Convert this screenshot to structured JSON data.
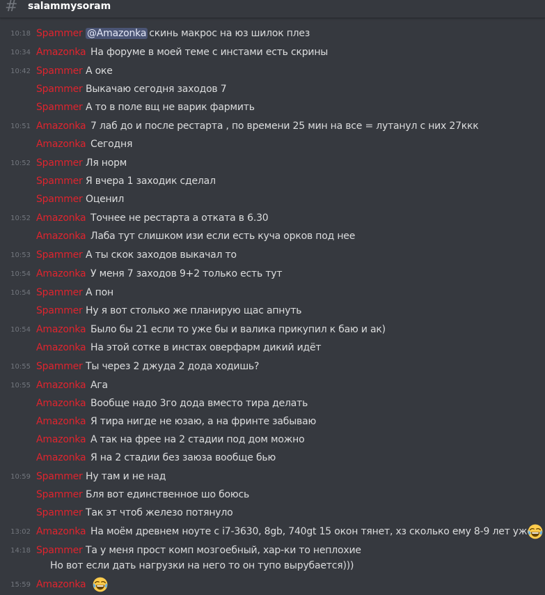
{
  "channel": {
    "name": "salammysoram"
  },
  "messages": [
    {
      "ts": "10:18",
      "author": "Spammer",
      "mention": "@Amazonka",
      "text": "скинь макрос на юз шилок плез"
    },
    {
      "ts": "10:34",
      "author": "Amazonka",
      "text": "На форуме в моей теме с инстами есть скрины"
    },
    {
      "ts": "10:42",
      "author": "Spammer",
      "text": "А оке"
    },
    {
      "ts": "",
      "author": "Spammer",
      "text": "Выкачаю сегодня заходов 7"
    },
    {
      "ts": "",
      "author": "Spammer",
      "text": "А то в поле вщ не варик фармить"
    },
    {
      "ts": "10:51",
      "author": "Amazonka",
      "text": "7 лаб до и после рестарта , по времени 25 мин на все = лутанул с них 27ккк"
    },
    {
      "ts": "",
      "author": "Amazonka",
      "text": "Сегодня"
    },
    {
      "ts": "10:52",
      "author": "Spammer",
      "text": "Ля норм"
    },
    {
      "ts": "",
      "author": "Spammer",
      "text": "Я вчера 1 заходик сделал"
    },
    {
      "ts": "",
      "author": "Spammer",
      "text": "Оценил"
    },
    {
      "ts": "10:52",
      "author": "Amazonka",
      "text": "Точнее не рестарта а отката в 6.30"
    },
    {
      "ts": "",
      "author": "Amazonka",
      "text": "Лаба тут слишком изи если есть куча орков под нее"
    },
    {
      "ts": "10:53",
      "author": "Spammer",
      "text": "А ты скок заходов выкачал то"
    },
    {
      "ts": "10:54",
      "author": "Amazonka",
      "text": "У меня 7 заходов 9+2 только есть тут"
    },
    {
      "ts": "10:54",
      "author": "Spammer",
      "text": "А пон"
    },
    {
      "ts": "",
      "author": "Spammer",
      "text": "Ну я вот столько же планирую щас апнуть"
    },
    {
      "ts": "10:54",
      "author": "Amazonka",
      "text": "Было бы 21 если то уже бы и валика прикупил к баю и ак)"
    },
    {
      "ts": "",
      "author": "Amazonka",
      "text": "На этой сотке в инстах оверфарм дикий идёт"
    },
    {
      "ts": "10:55",
      "author": "Spammer",
      "text": "Ты через 2 джуда 2 дода ходишь?"
    },
    {
      "ts": "10:55",
      "author": "Amazonka",
      "text": "Ага"
    },
    {
      "ts": "",
      "author": "Amazonka",
      "text": "Вообще надо 3го дода вместо тира делать"
    },
    {
      "ts": "",
      "author": "Amazonka",
      "text": "Я тира нигде не юзаю, а на фринте забываю"
    },
    {
      "ts": "",
      "author": "Amazonka",
      "text": "А так на фрее на 2 стадии под дом можно"
    },
    {
      "ts": "",
      "author": "Amazonka",
      "text": "Я на 2 стадии без заюза вообще бью"
    },
    {
      "ts": "10:59",
      "author": "Spammer",
      "text": "Ну там и не над"
    },
    {
      "ts": "",
      "author": "Spammer",
      "text": "Бля вот единственное шо боюсь"
    },
    {
      "ts": "",
      "author": "Spammer",
      "text": "Так эт чтоб железо потянуло"
    },
    {
      "ts": "13:02",
      "author": "Amazonka",
      "text": "На моём древнем ноуте с i7-3630, 8gb, 740gt 15 окон тянет, хз сколько ему 8-9 лет уже",
      "emoji": "joy-emoji"
    },
    {
      "ts": "14:18",
      "author": "Spammer",
      "text": "Та у меня прост комп мозгоебный, хар-ки то неплохие",
      "text2": "Но вот если дать нагрузки на него то он тупо вырубается)))"
    },
    {
      "ts": "15:59",
      "author": "Amazonka",
      "text": "",
      "emoji": "joy-emoji"
    }
  ],
  "colors": {
    "background": "#36393f",
    "author": "#e0242e",
    "text": "#dcddde",
    "timestamp": "#72767d",
    "mention_bg": "#4e5b8f"
  }
}
